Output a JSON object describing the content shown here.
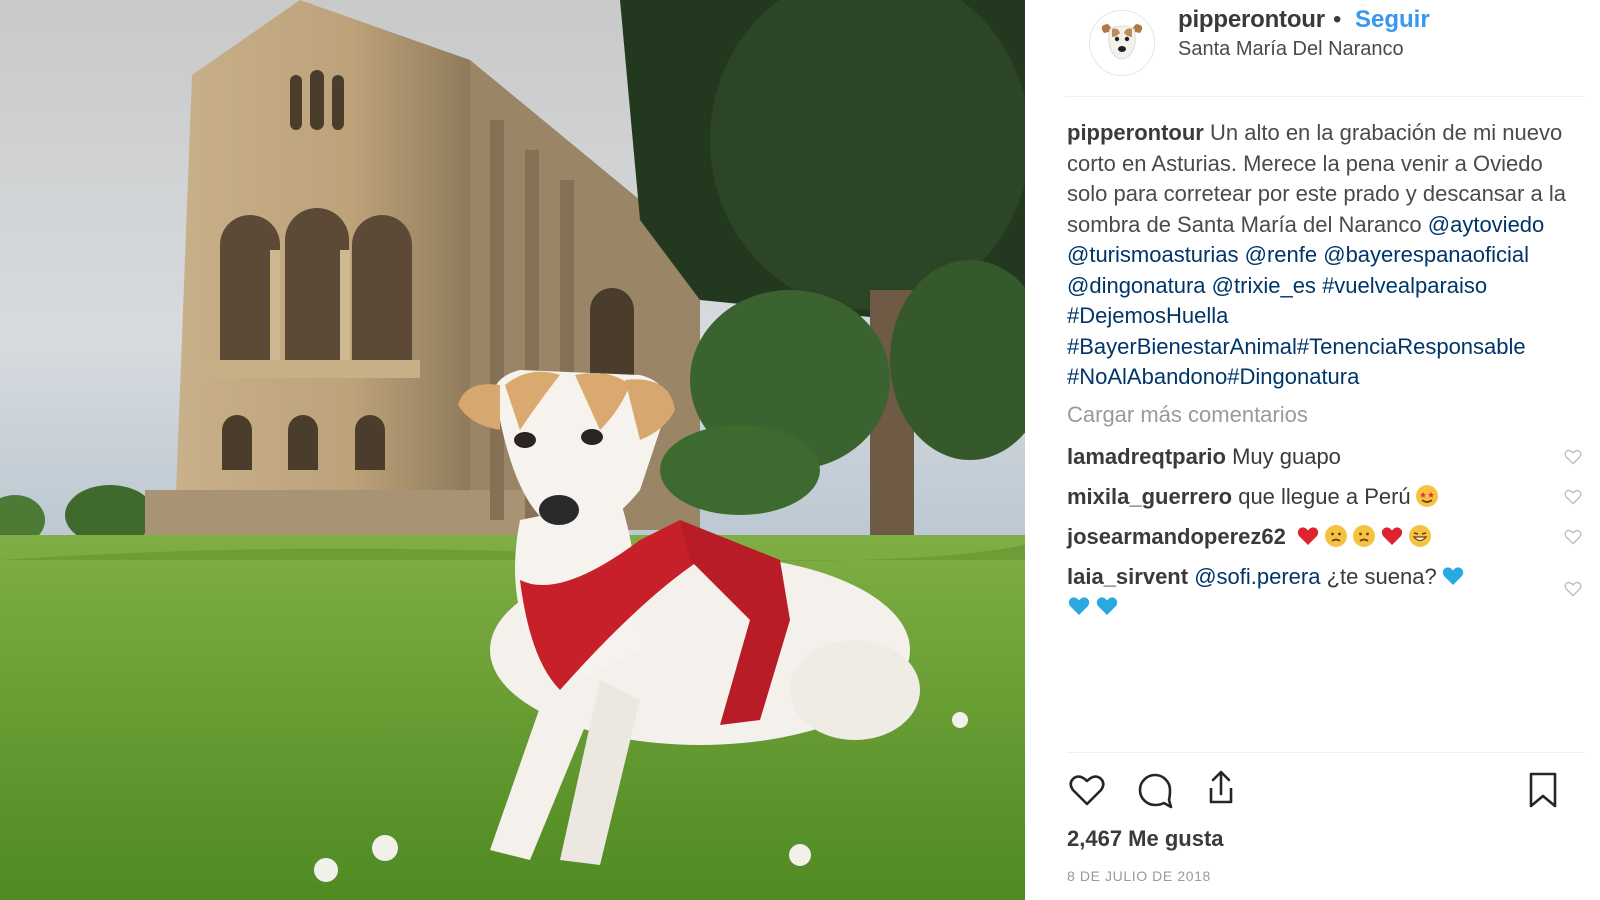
{
  "post": {
    "username": "pipperontour",
    "separator": "•",
    "follow_label": "Seguir",
    "location": "Santa María Del Naranco",
    "caption": {
      "user": "pipperontour",
      "text": "Un alto en la grabación de mi nuevo corto en Asturias. Merece la pena venir a Oviedo solo para corretear por este prado y descansar a la sombra de Santa María del Naranco",
      "tags": [
        "@aytoviedo",
        "@turismoasturias",
        "@renfe",
        "@bayerespanaoficial",
        "@dingonatura",
        "@trixie_es",
        "#vuelvealparaiso",
        "#DejemosHuella",
        "#BayerBienestarAnimal",
        "#TenenciaResponsable",
        "#NoAlAbandono",
        "#Dingonatura"
      ]
    },
    "load_more_label": "Cargar más comentarios",
    "comments": [
      {
        "user": "lamadreqtpario",
        "text": "Muy guapo",
        "emojis": []
      },
      {
        "user": "mixila_guerrero",
        "text": "que llegue a Perú",
        "emojis": [
          "star-struck"
        ]
      },
      {
        "user": "josearmandoperez62",
        "text": "",
        "emojis": [
          "red-heart",
          "sad-face",
          "sad-face",
          "red-heart",
          "grin-sweat"
        ]
      },
      {
        "user": "laia_sirvent",
        "mention": "@sofi.perera",
        "text": "¿te suena?",
        "emojis": [
          "blue-heart",
          "blue-heart",
          "blue-heart"
        ]
      }
    ],
    "likes": "2,467 Me gusta",
    "date": "8 DE JULIO DE 2018"
  },
  "colors": {
    "link": "#003569",
    "follow": "#3897f0",
    "harness": "#c8202a",
    "grass": "#5f9a2e"
  },
  "icons": [
    "heart-icon",
    "comment-icon",
    "share-icon",
    "bookmark-icon",
    "like-comment-icon"
  ]
}
